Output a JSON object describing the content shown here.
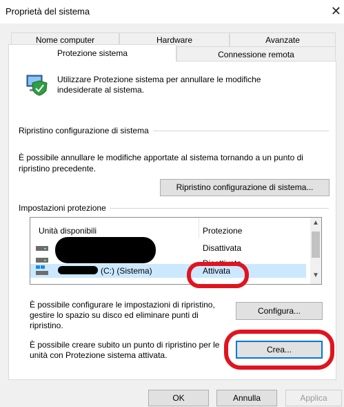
{
  "window": {
    "title": "Proprietà del sistema",
    "close_glyph": "✕"
  },
  "tabs": {
    "row1": [
      "Nome computer",
      "Hardware",
      "Avanzate"
    ],
    "row2": [
      "Protezione sistema",
      "Connessione remota"
    ],
    "active": "Protezione sistema"
  },
  "intro": {
    "icon": "system-protection-shield-icon",
    "text": "Utilizzare Protezione sistema per annullare le modifiche indesiderate al sistema."
  },
  "ripristino": {
    "group_title": "Ripristino configurazione di sistema",
    "description": "È possibile annullare le modifiche apportate al sistema tornando a un punto di ripristino precedente.",
    "button": "Ripristino configurazione di sistema..."
  },
  "impostazioni": {
    "group_title": "Impostazioni protezione",
    "columns": [
      "Unità disponibili",
      "Protezione"
    ],
    "rows": [
      {
        "drive": "",
        "protection": "Disattivata"
      },
      {
        "drive": "",
        "protection": "Disattivata"
      },
      {
        "drive": "(C:) (Sistema)",
        "protection": "Attivata"
      }
    ],
    "configure_text": "È possibile configurare le impostazioni di ripristino, gestire lo spazio su disco ed eliminare punti di ripristino.",
    "configure_button": "Configura...",
    "create_text": "È possibile creare subito un punto di ripristino per le unità con Protezione sistema attivata.",
    "create_button": "Crea..."
  },
  "footer": {
    "ok": "OK",
    "cancel": "Annulla",
    "apply": "Applica"
  },
  "colors": {
    "selection": "#cce8ff",
    "annotation_red": "#e0141f",
    "focus_blue": "#0078d7"
  },
  "scroll": {
    "up": "▲",
    "down": "▼"
  }
}
